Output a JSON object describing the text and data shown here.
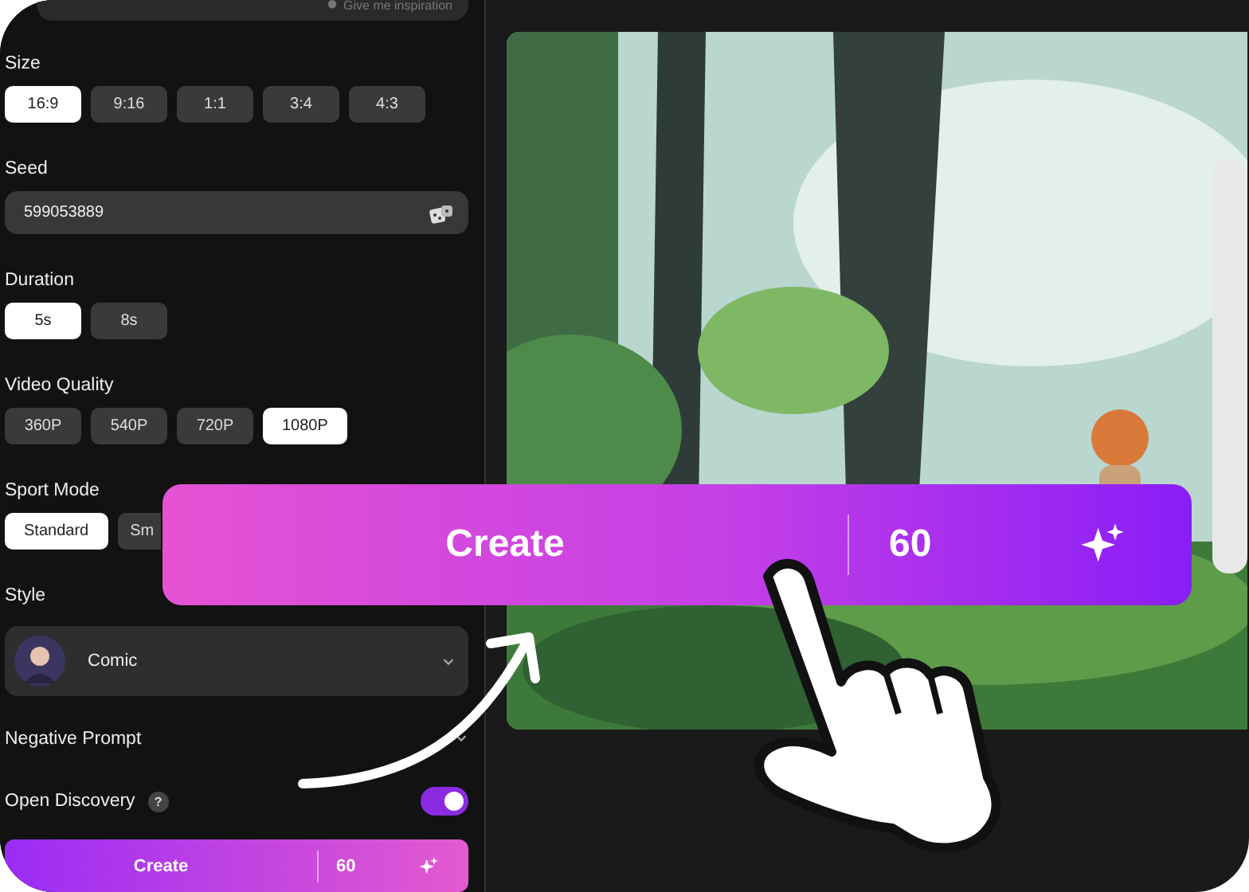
{
  "inspiration_field": {
    "text": "Give me inspiration"
  },
  "sections": [
    {
      "label": "Size",
      "kind": "options",
      "options": [
        {
          "label": "16:9",
          "selected": true
        },
        {
          "label": "9:16",
          "selected": false
        },
        {
          "label": "1:1",
          "selected": false
        },
        {
          "label": "3:4",
          "selected": false
        },
        {
          "label": "4:3",
          "selected": false
        }
      ]
    },
    {
      "label": "Seed",
      "kind": "seed",
      "value": "599053889"
    },
    {
      "label": "Duration",
      "kind": "options",
      "options": [
        {
          "label": "5s",
          "selected": true
        },
        {
          "label": "8s",
          "selected": false
        }
      ]
    },
    {
      "label": "Video Quality",
      "kind": "options",
      "options": [
        {
          "label": "360P",
          "selected": false
        },
        {
          "label": "540P",
          "selected": false
        },
        {
          "label": "720P",
          "selected": false
        },
        {
          "label": "1080P",
          "selected": true
        }
      ]
    },
    {
      "label": "Sport Mode",
      "kind": "options",
      "options": [
        {
          "label": "Standard",
          "selected": true
        },
        {
          "label": "Sm",
          "selected": false
        }
      ]
    },
    {
      "label": "Style",
      "kind": "dropdown",
      "value": "Comic"
    }
  ],
  "negative_prompt": {
    "label": "Negative Prompt"
  },
  "open_discovery": {
    "label": "Open Discovery",
    "help": "?",
    "on": true
  },
  "create_button": {
    "label": "Create",
    "cost": "60"
  },
  "overlay_create_button": {
    "label": "Create",
    "cost": "60"
  }
}
